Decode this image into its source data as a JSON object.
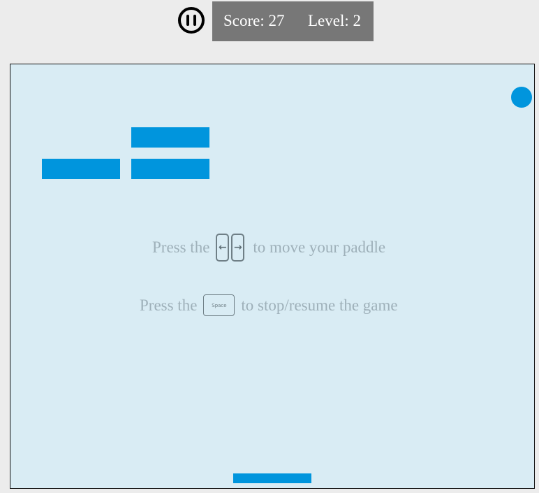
{
  "hud": {
    "pause_icon": "pause-circle-icon",
    "score_text": "Score: 27",
    "level_text": "Level: 2"
  },
  "game": {
    "ball_color": "#0095dd",
    "brick_color": "#0095dd",
    "paddle_color": "#0095dd",
    "board_background": "#d9ecf4",
    "bricks_remaining": 3
  },
  "instructions": {
    "move": {
      "prefix": "Press the",
      "left_key": "←",
      "right_key": "→",
      "suffix": "to move your paddle"
    },
    "pause": {
      "prefix": "Press the",
      "key_label": "Space",
      "suffix": "to stop/resume the game"
    }
  }
}
